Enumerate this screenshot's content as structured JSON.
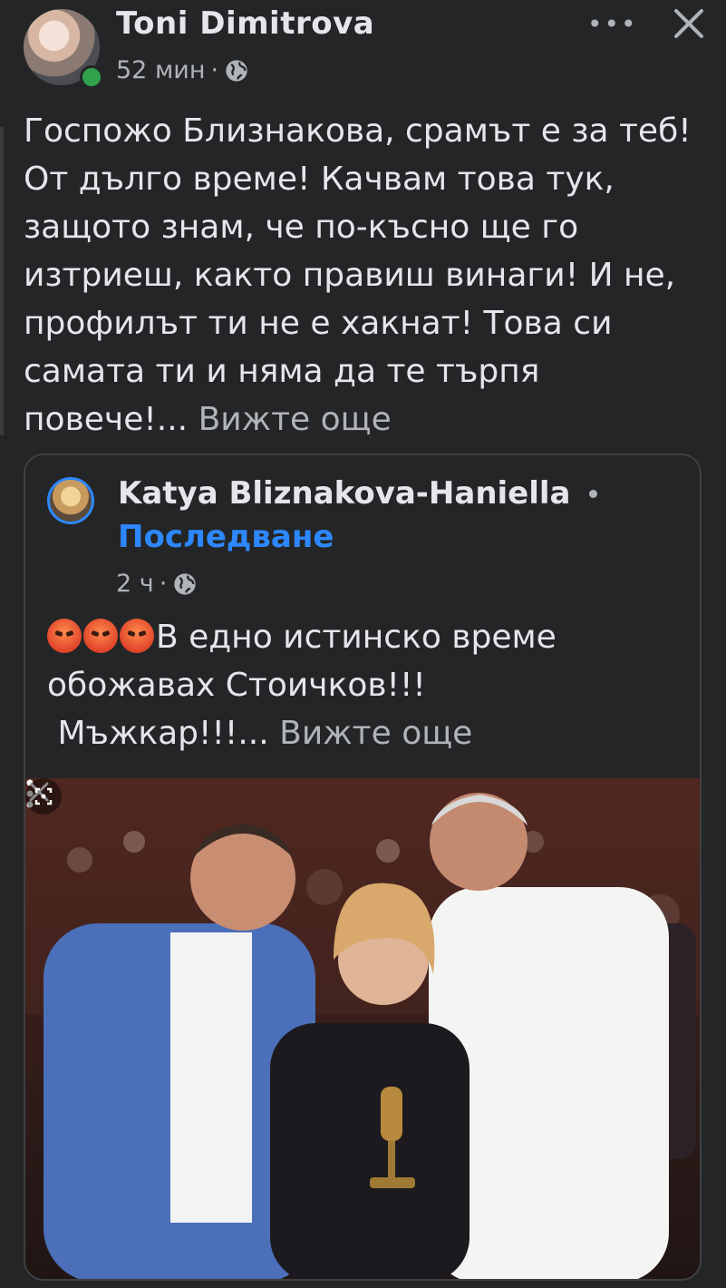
{
  "post": {
    "author": "Toni Dimitrova",
    "time": "52 мин",
    "separator": "·",
    "text": "Госпожо Близнакова, срамът е за теб! От дълго време! Качвам това тук, защото знам, че  по-късно ще го изтриеш, както правиш винаги! И не, профилът ти не е хакнат! Това си самата ти и няма да те търпя повече!...",
    "see_more": "Вижте още",
    "more_icon": "•••"
  },
  "shared": {
    "author": "Katya Bliznakova-Haniella",
    "follow": "Последване",
    "time": "2 ч",
    "separator": "·",
    "text_line1": "В едно истинско време обожавах Стоичков!!!",
    "text_line2": "Мъжкар!!!...",
    "see_more": "Вижте още"
  },
  "colors": {
    "background": "#242526",
    "link": "#2d88ff",
    "online": "#31a24c",
    "muted": "#b0b3b8"
  }
}
